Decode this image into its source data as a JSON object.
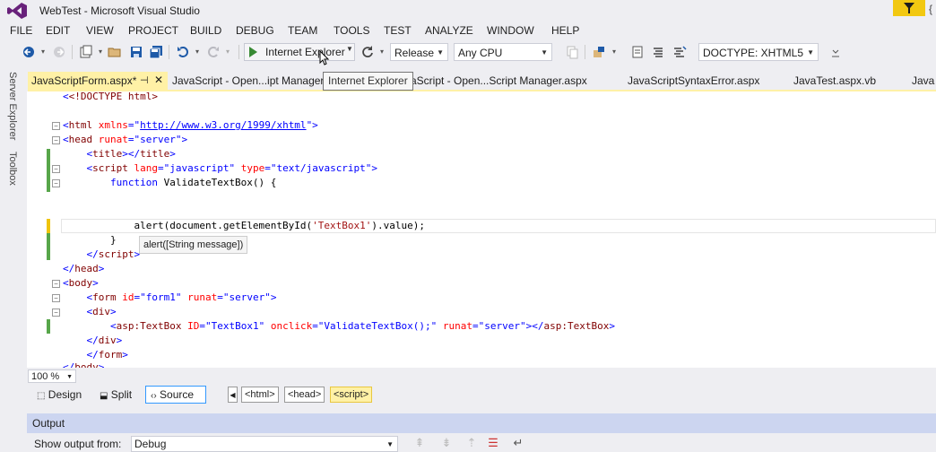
{
  "window": {
    "title": "WebTest - Microsoft Visual Studio",
    "notif_bracket": "{"
  },
  "menu": [
    "FILE",
    "EDIT",
    "VIEW",
    "PROJECT",
    "BUILD",
    "DEBUG",
    "TEAM",
    "TOOLS",
    "TEST",
    "ANALYZE",
    "WINDOW",
    "HELP"
  ],
  "toolbar": {
    "run_label": "Internet Explorer",
    "configuration": "Release",
    "platform": "Any CPU",
    "doctype": "DOCTYPE: XHTML5",
    "tooltip": "Internet Explorer"
  },
  "side_rail": {
    "server_explorer": "Server Explorer",
    "toolbox": "Toolbox"
  },
  "tabs": {
    "active": "JavaScriptForm.aspx*",
    "others": [
      "JavaScript - Open...ipt Manager",
      "vaScript - Open...Script Manager.aspx",
      "JavaScriptSyntaxError.aspx",
      "JavaTest.aspx.vb",
      "Java"
    ]
  },
  "code": {
    "l1": "<!DOCTYPE html>",
    "xmlns_url": "http://www.w3.org/1999/xhtml",
    "alert_line_pre": "alert(document.getElementById(",
    "alert_arg": "'TextBox1'",
    "alert_line_post": ").value);",
    "param_info": "alert([String message])"
  },
  "editor": {
    "zoom": "100 %"
  },
  "view": {
    "design": "Design",
    "split": "Split",
    "source": "Source"
  },
  "breadcrumb": [
    "<html>",
    "<head>",
    "<script>"
  ],
  "output": {
    "title": "Output",
    "show_from_label": "Show output from:",
    "source": "Debug"
  },
  "colors": {
    "accent_tab": "#fff1a6",
    "output_header": "#ccd5f0",
    "run_green": "#388a34",
    "vs_purple": "#68217a"
  }
}
